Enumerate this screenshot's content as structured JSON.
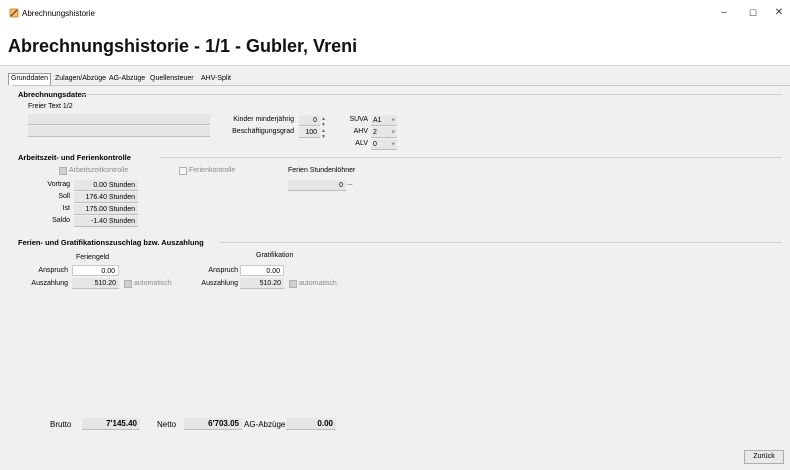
{
  "window": {
    "title": "Abrechnungshistorie",
    "minimize": "–",
    "maximize": "☐",
    "close": "✕"
  },
  "page": {
    "title": "Abrechnungshistorie - 1/1 - Gubler, Vreni"
  },
  "tabs": [
    "Grunddaten",
    "Zulagen/Abzüge",
    "AG-Abzüge",
    "Quellensteuer",
    "AHV-Split"
  ],
  "abrechnungsdaten": {
    "title": "Abrechnungsdaten",
    "freier_text_label": "Freier Text 1/2",
    "kinder_label": "Kinder minderjährig",
    "kinder_value": "0",
    "grad_label": "Beschäftigungsgrad",
    "grad_value": "100",
    "suva_label": "SUVA",
    "suva_value": "A1",
    "ahv_label": "AHV",
    "ahv_value": "2",
    "alv_label": "ALV",
    "alv_value": "0"
  },
  "arbeitszeit": {
    "title": "Arbeitszeit- und Ferienkontrolle",
    "arbeitszeitkontrolle_label": "Arbeitszeitkontrolle",
    "ferienkontrolle_label": "Ferienkontrolle",
    "ferien_stundenloehner_label": "Ferien Stundenlöhner",
    "ferien_stundenloehner_value": "0",
    "ellipsis": "...",
    "rows": [
      {
        "label": "Vortrag",
        "value": "0.00 Stunden"
      },
      {
        "label": "Soll",
        "value": "176.40 Stunden"
      },
      {
        "label": "Ist",
        "value": "175.00 Stunden"
      },
      {
        "label": "Saldo",
        "value": "-1.40 Stunden"
      }
    ]
  },
  "ferienzuschlag": {
    "title": "Ferien- und Gratifikationszuschlag bzw. Auszahlung",
    "feriengeld_header": "Feriengeld",
    "gratifikation_header": "Gratifikation",
    "anspruch_label": "Anspruch",
    "auszahlung_label": "Auszahlung",
    "automatisch_label": "automatisch",
    "feriengeld_anspruch": "0.00",
    "feriengeld_auszahlung": "510.20",
    "grat_anspruch": "0.00",
    "grat_auszahlung": "510.20"
  },
  "totals": {
    "brutto_label": "Brutto",
    "brutto_value": "7'145.40",
    "netto_label": "Netto",
    "netto_value": "6'703.05",
    "ag_label": "AG-Abzüge",
    "ag_value": "0.00"
  },
  "footer": {
    "back_label": "Zurück"
  }
}
